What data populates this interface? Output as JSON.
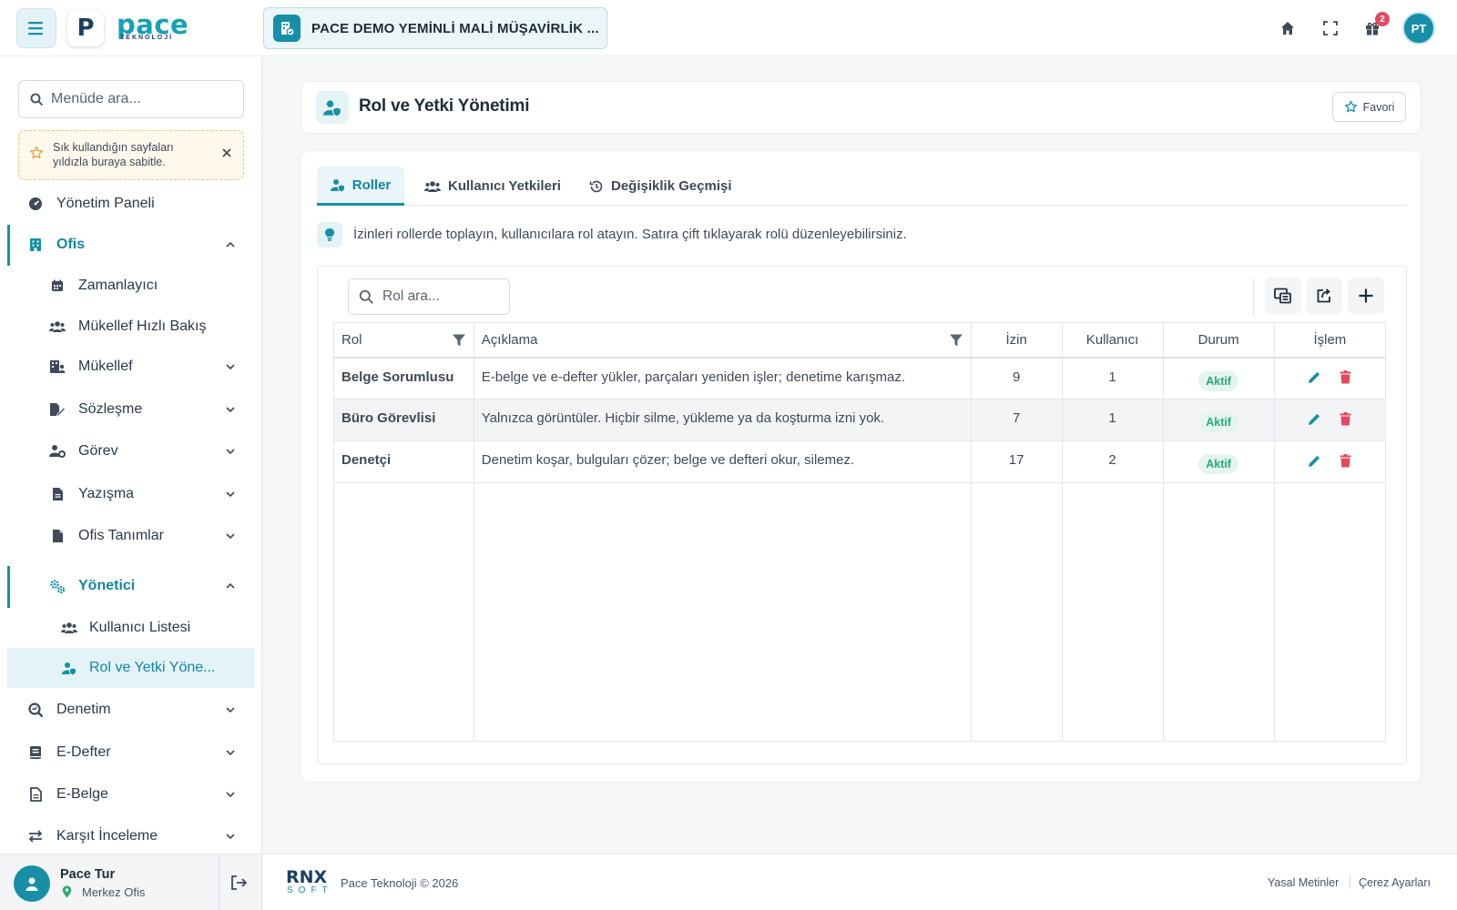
{
  "header": {
    "logo_letter": "P",
    "logo_word": "pace",
    "logo_sub": "TEKNOLOJİ",
    "company": "PACE DEMO YEMİNLİ MALİ MÜŞAVİRLİK ...",
    "notification_count": "2",
    "avatar_initials": "PT"
  },
  "sidebar": {
    "search_placeholder": "Menüde ara...",
    "fav_hint": "Sık kullandığın sayfaları yıldızla buraya sabitle.",
    "items": [
      {
        "label": "Yönetim Paneli",
        "icon": "dashboard-icon"
      },
      {
        "label": "Ofis",
        "icon": "building-icon",
        "state": "open"
      },
      {
        "label": "Zamanlayıcı",
        "icon": "calendar-icon"
      },
      {
        "label": "Mükellef Hızlı Bakış",
        "icon": "users-icon"
      },
      {
        "label": "Mükellef",
        "icon": "building-user-icon"
      },
      {
        "label": "Sözleşme",
        "icon": "file-signature-icon"
      },
      {
        "label": "Görev",
        "icon": "user-gear-icon"
      },
      {
        "label": "Yazışma",
        "icon": "document-icon"
      },
      {
        "label": "Ofis Tanımlar",
        "icon": "file-icon"
      },
      {
        "label": "Yönetici",
        "icon": "gears-icon",
        "state": "open"
      },
      {
        "label": "Kullanıcı Listesi",
        "icon": "users-icon"
      },
      {
        "label": "Rol ve Yetki Yöne...",
        "icon": "user-shield-icon",
        "state": "active"
      },
      {
        "label": "Denetim",
        "icon": "magnifier-icon"
      },
      {
        "label": "E-Defter",
        "icon": "book-icon"
      },
      {
        "label": "E-Belge",
        "icon": "file-text-icon"
      },
      {
        "label": "Karşıt İnceleme",
        "icon": "arrows-icon"
      }
    ],
    "user": {
      "name": "Pace Tur",
      "office": "Merkez Ofis"
    }
  },
  "page": {
    "title": "Rol ve Yetki Yönetimi",
    "favorite_label": "Favori",
    "tabs": [
      {
        "label": "Roller",
        "active": true
      },
      {
        "label": "Kullanıcı Yetkileri"
      },
      {
        "label": "Değişiklik Geçmişi"
      }
    ],
    "info": "İzinleri rollerde toplayın, kullanıcılara rol atayın. Satıra çift tıklayarak rolü düzenleyebilirsiniz.",
    "search_placeholder": "Rol ara...",
    "columns": [
      "Rol",
      "Açıklama",
      "İzin",
      "Kullanıcı",
      "Durum",
      "İşlem"
    ],
    "rows": [
      {
        "role": "Belge Sorumlusu",
        "desc": "E-belge ve e-defter yükler, parçaları yeniden işler; denetime karışmaz.",
        "perms": "9",
        "users": "1",
        "status": "Aktif"
      },
      {
        "role": "Büro Görevlisi",
        "desc": "Yalnızca görüntüler. Hiçbir silme, yükleme ya da koşturma izni yok.",
        "perms": "7",
        "users": "1",
        "status": "Aktif"
      },
      {
        "role": "Denetçi",
        "desc": "Denetim koşar, bulguları çözer; belge ve defteri okur, silemez.",
        "perms": "17",
        "users": "2",
        "status": "Aktif"
      }
    ]
  },
  "footer": {
    "logo_top": "RNX",
    "logo_bottom": "SOFT",
    "copyright": "Pace Teknoloji © 2026",
    "links": [
      "Yasal Metinler",
      "Çerez Ayarları"
    ]
  },
  "colors": {
    "accent": "#178fa7",
    "danger": "#e14a5f",
    "success": "#2aa877",
    "warning_bg": "#fff8ec"
  }
}
